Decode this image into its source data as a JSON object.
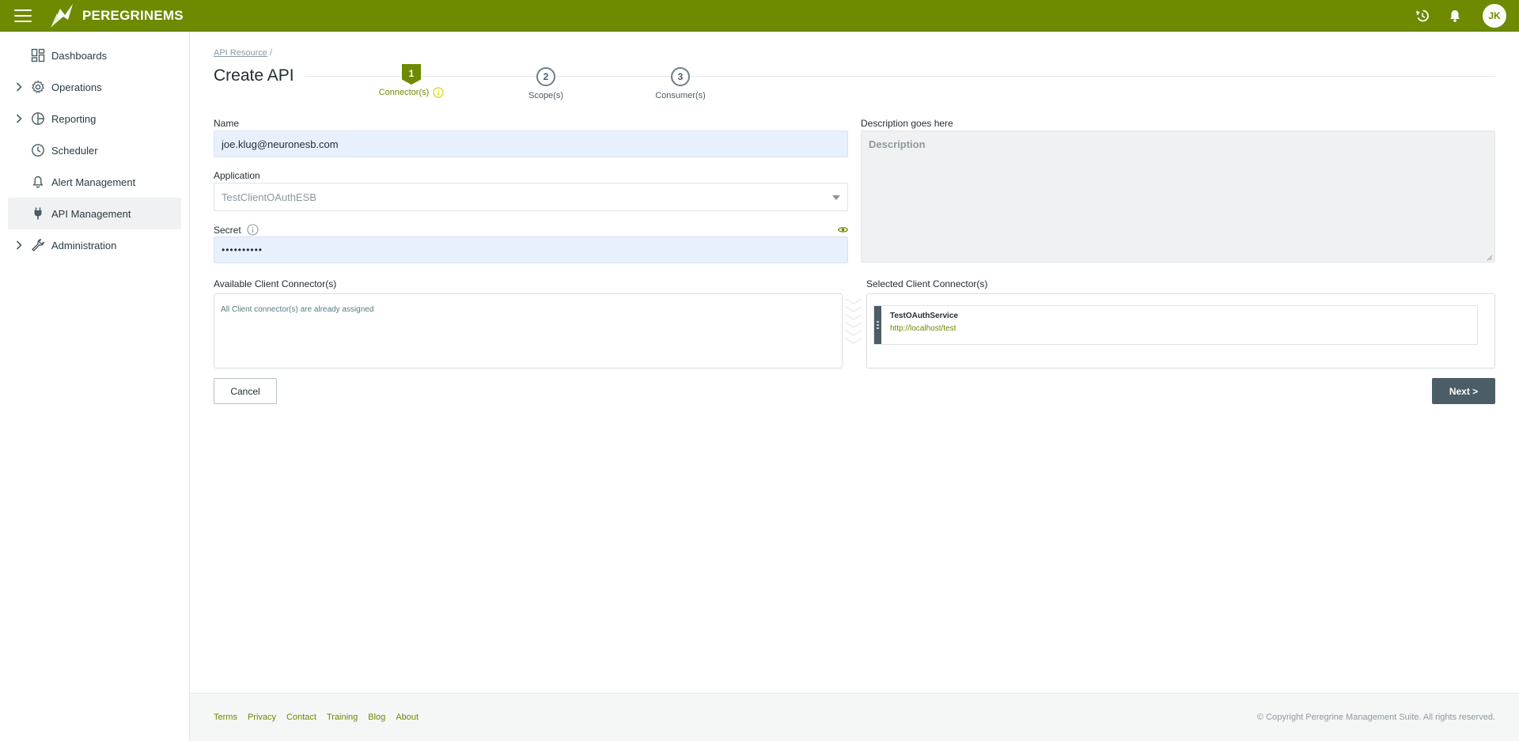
{
  "topbar": {
    "brand": "PEREGRINEMS",
    "avatar_initials": "JK",
    "icons": [
      "menu-icon",
      "history-icon",
      "bell-icon"
    ],
    "color": "#6d8a00"
  },
  "sidebar": {
    "items": [
      {
        "label": "Dashboards",
        "icon": "dashboard-icon",
        "expandable": false,
        "active": false
      },
      {
        "label": "Operations",
        "icon": "gear-icon",
        "expandable": true,
        "active": false
      },
      {
        "label": "Reporting",
        "icon": "pie-chart-icon",
        "expandable": true,
        "active": false
      },
      {
        "label": "Scheduler",
        "icon": "clock-icon",
        "expandable": false,
        "active": false
      },
      {
        "label": "Alert Management",
        "icon": "bell-icon",
        "expandable": false,
        "active": false
      },
      {
        "label": "API Management",
        "icon": "plug-icon",
        "expandable": false,
        "active": true
      },
      {
        "label": "Administration",
        "icon": "wrench-icon",
        "expandable": true,
        "active": false
      }
    ]
  },
  "breadcrumb": {
    "link": "API Resource",
    "separator": "/"
  },
  "page_title": "Create API",
  "stepper": {
    "steps": [
      {
        "number": "1",
        "label": "Connector(s)",
        "active": true
      },
      {
        "number": "2",
        "label": "Scope(s)",
        "active": false
      },
      {
        "number": "3",
        "label": "Consumer(s)",
        "active": false
      }
    ]
  },
  "form": {
    "name_label": "Name",
    "name_value": "joe.klug@neuronesb.com",
    "application_label": "Application",
    "application_value": "TestClientOAuthESB",
    "secret_label": "Secret",
    "secret_value": "••••••••••",
    "description_label": "Description goes here",
    "description_placeholder": "Description"
  },
  "connectors": {
    "available_label": "Available Client Connector(s)",
    "available_empty": "All Client connector(s) are already assigned",
    "selected_label": "Selected Client Connector(s)",
    "selected": [
      {
        "name": "TestOAuthService",
        "url": "http://localhost/test"
      }
    ]
  },
  "actions": {
    "cancel": "Cancel",
    "next": "Next >"
  },
  "footer": {
    "links": [
      "Terms",
      "Privacy",
      "Contact",
      "Training",
      "Blog",
      "About"
    ],
    "copyright": "© Copyright Peregrine Management Suite. All rights reserved."
  }
}
